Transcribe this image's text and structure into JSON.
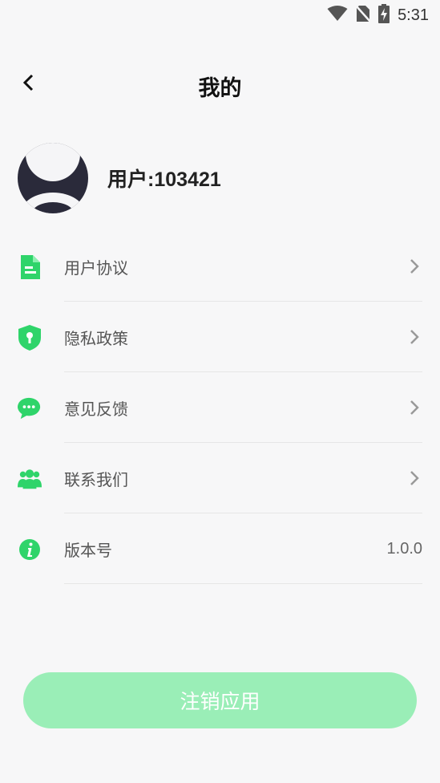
{
  "status_bar": {
    "time": "5:31",
    "icons": [
      "wifi-icon",
      "no-sim-icon",
      "battery-charging-icon"
    ]
  },
  "header": {
    "title": "我的",
    "back_icon": "chevron-left-icon"
  },
  "profile": {
    "username": "用户:103421"
  },
  "menu": {
    "items": [
      {
        "label": "用户协议",
        "icon": "document-icon"
      },
      {
        "label": "隐私政策",
        "icon": "shield-icon"
      },
      {
        "label": "意见反馈",
        "icon": "chat-bubble-icon"
      },
      {
        "label": "联系我们",
        "icon": "users-icon"
      },
      {
        "label": "版本号",
        "icon": "info-icon",
        "value": "1.0.0"
      }
    ]
  },
  "logout_button": {
    "label": "注销应用"
  },
  "colors": {
    "accent": "#2fd46a",
    "button_bg": "#9aeeb7",
    "background": "#f7f7f8",
    "avatar_dark": "#2a2a3a"
  }
}
